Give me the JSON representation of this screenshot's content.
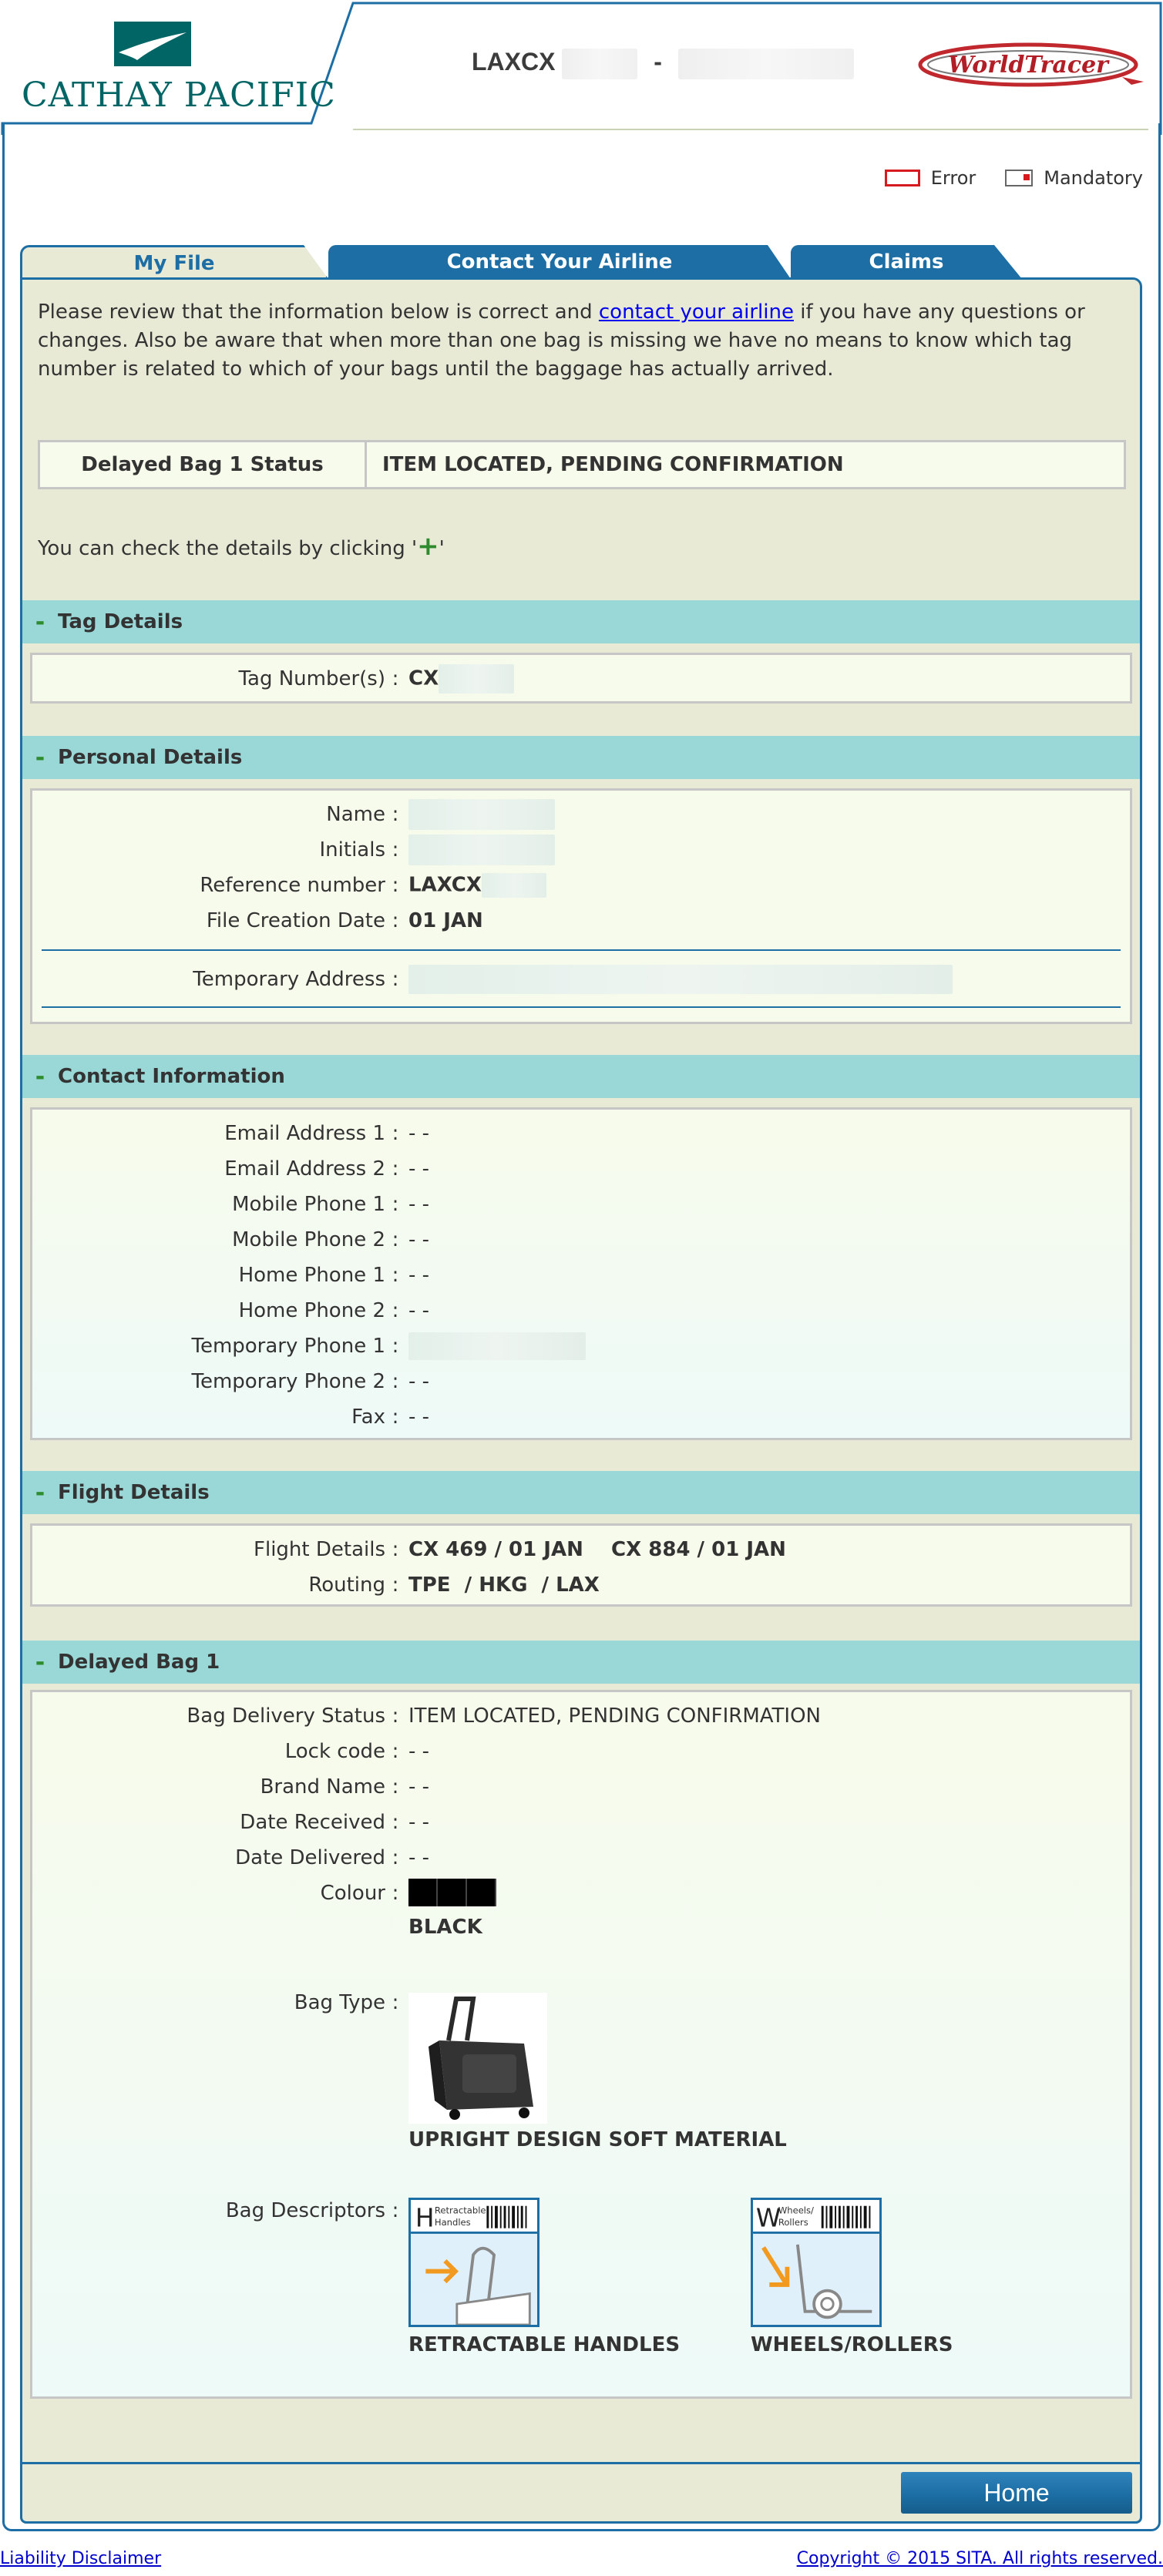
{
  "header": {
    "brand_name": "CATHAY PACIFIC",
    "file_ref_prefix": "LAXCX",
    "file_ref_separator": "-",
    "worldtracer_logo": "WorldTracer"
  },
  "legend": {
    "error_label": "Error",
    "mandatory_label": "Mandatory"
  },
  "tabs": {
    "my_file": "My File",
    "contact_airline": "Contact Your Airline",
    "claims": "Claims"
  },
  "intro": {
    "text_before_link": "Please review that the information below is correct and ",
    "link_text": "contact your airline",
    "text_after_link": " if you have any questions or changes. Also be aware that when more than one bag is missing we have no means to know which tag number is related to which of your bags until the baggage has actually arrived."
  },
  "status": {
    "label": "Delayed Bag 1 Status",
    "value": "ITEM LOCATED, PENDING CONFIRMATION"
  },
  "check_hint": {
    "before": "You can check the details by clicking '",
    "plus": "+",
    "after": "'"
  },
  "sections": {
    "toggle": "-",
    "tag_details": {
      "title": "Tag Details",
      "tag_number_label": "Tag Number(s)",
      "tag_number_value": "CX"
    },
    "personal_details": {
      "title": "Personal Details",
      "name_label": "Name",
      "initials_label": "Initials",
      "reference_label": "Reference number",
      "reference_value": "LAXCX",
      "file_creation_label": "File Creation Date",
      "file_creation_value": "01 JAN",
      "temp_address_label": "Temporary Address"
    },
    "contact_information": {
      "title": "Contact Information",
      "rows": [
        {
          "label": "Email Address 1",
          "value": "- -"
        },
        {
          "label": "Email Address 2",
          "value": "- -"
        },
        {
          "label": "Mobile Phone 1",
          "value": "- -"
        },
        {
          "label": "Mobile Phone 2",
          "value": "- -"
        },
        {
          "label": "Home Phone 1",
          "value": "- -"
        },
        {
          "label": "Home Phone 2",
          "value": "- -"
        },
        {
          "label": "Temporary Phone 1",
          "value": ""
        },
        {
          "label": "Temporary Phone 2",
          "value": "- -"
        },
        {
          "label": "Fax",
          "value": "- -"
        }
      ]
    },
    "flight_details": {
      "title": "Flight Details",
      "flight_label": "Flight Details",
      "flight_value": "CX 469 / 01 JAN    CX 884 / 01 JAN",
      "routing_label": "Routing",
      "routing_value": "TPE  / HKG  / LAX"
    },
    "delayed_bag": {
      "title": "Delayed Bag 1",
      "rows": [
        {
          "label": "Bag Delivery Status",
          "value": "ITEM LOCATED, PENDING CONFIRMATION"
        },
        {
          "label": "Lock code",
          "value": "- -"
        },
        {
          "label": "Brand Name",
          "value": "- -"
        },
        {
          "label": "Date Received",
          "value": "- -"
        },
        {
          "label": "Date Delivered",
          "value": "- -"
        }
      ],
      "colour_label": "Colour",
      "colour_value": "BLACK",
      "colour_hex": "#000000",
      "bag_type_label": "Bag Type",
      "bag_type_value": "UPRIGHT DESIGN SOFT MATERIAL",
      "bag_descriptors_label": "Bag Descriptors",
      "descriptors": [
        {
          "code": "H",
          "caption": "Retractable Handles",
          "label": "RETRACTABLE HANDLES"
        },
        {
          "code": "W",
          "caption": "Wheels/ Rollers",
          "label": "WHEELS/ROLLERS"
        }
      ]
    }
  },
  "buttons": {
    "home": "Home"
  },
  "footer": {
    "disclaimer": "Liability Disclaimer",
    "copyright": "Copyright © 2015 SITA. All rights reserved."
  },
  "colors": {
    "brand_teal": "#006564",
    "primary_blue": "#1c6ea4",
    "panel_bg": "#e8ead6",
    "section_header": "#9ad8d8",
    "box_bg": "#f7fbeb",
    "error_red": "#d71920",
    "toggle_green": "#2e8b2e"
  }
}
